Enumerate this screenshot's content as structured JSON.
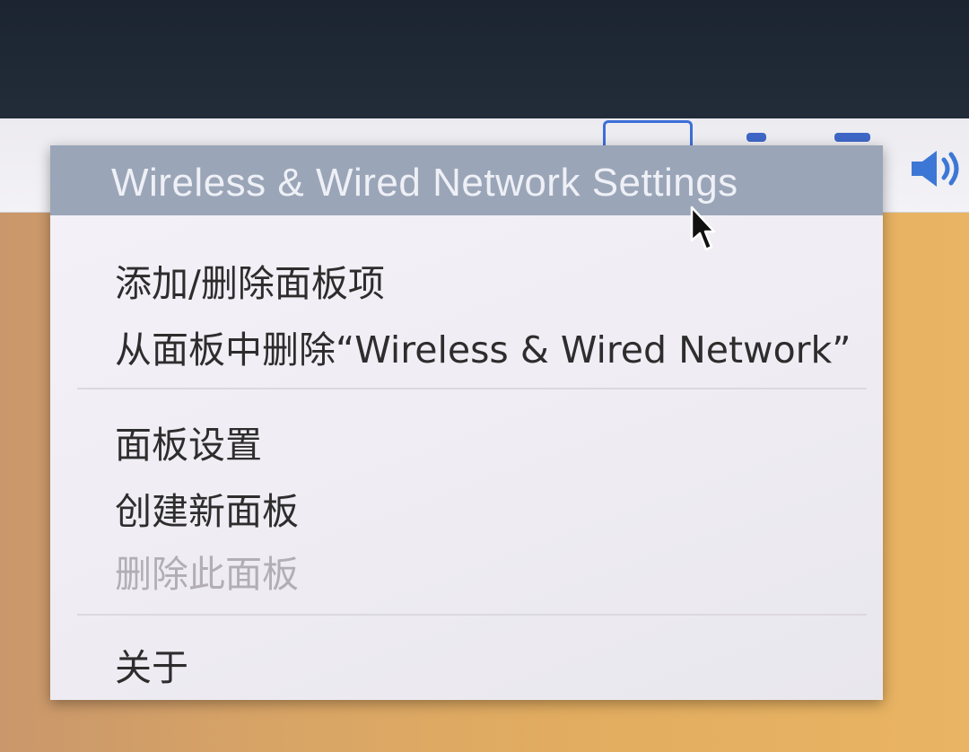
{
  "panel": {
    "icons": [
      "network-icon",
      "volume-icon"
    ]
  },
  "menu": {
    "header_label": "Wireless & Wired Network Settings",
    "items": [
      {
        "label": "添加/删除面板项",
        "enabled": true
      },
      {
        "label": "从面板中删除“Wireless & Wired Network”",
        "enabled": true
      },
      {
        "label": "面板设置",
        "enabled": true
      },
      {
        "label": "创建新面板",
        "enabled": true
      },
      {
        "label": "删除此面板",
        "enabled": false
      },
      {
        "label": "关于",
        "enabled": true
      }
    ]
  },
  "colors": {
    "header_bg": "#9aa5b8",
    "menu_bg": "#f4f1f8",
    "text": "#2d2d2d",
    "disabled_text": "#b3aeb6",
    "accent": "#3e6fd8"
  }
}
